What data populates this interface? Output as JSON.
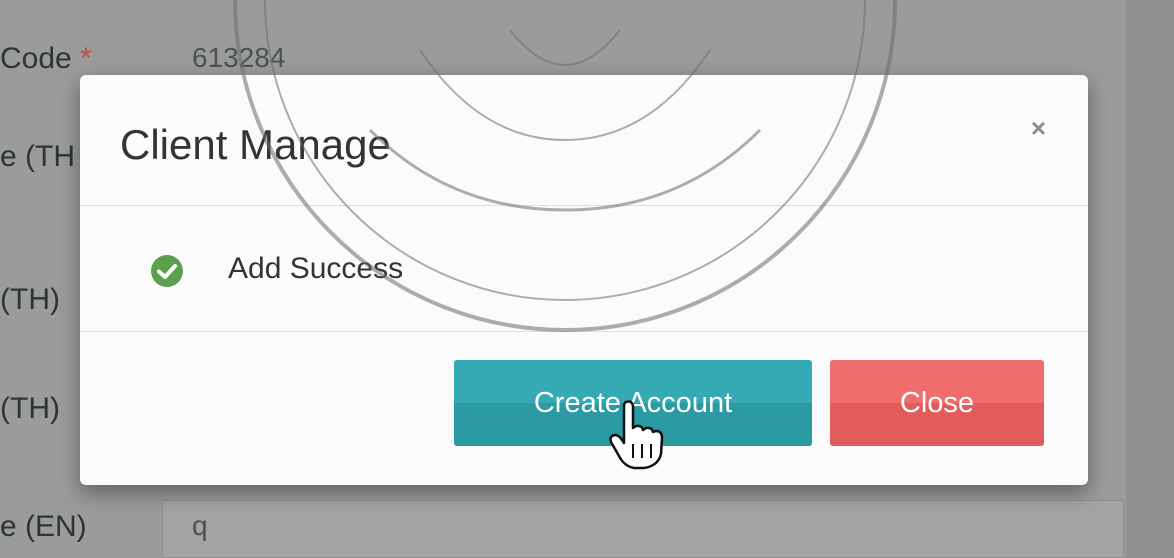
{
  "underlying_form": {
    "labels": [
      "Code",
      "e (TH",
      "(TH)",
      "(TH)",
      "e (EN)"
    ],
    "required_mark": "*",
    "code_value": "613284",
    "name_en_value": "q"
  },
  "modal": {
    "title": "Client Manage",
    "close_icon": "×",
    "message": "Add Success",
    "message_icon": "check-circle-icon",
    "buttons": {
      "create_account": "Create Account",
      "close": "Close"
    }
  },
  "colors": {
    "success": "#5aa04e",
    "create_button": "#35aab4",
    "close_button": "#f06d6d"
  }
}
